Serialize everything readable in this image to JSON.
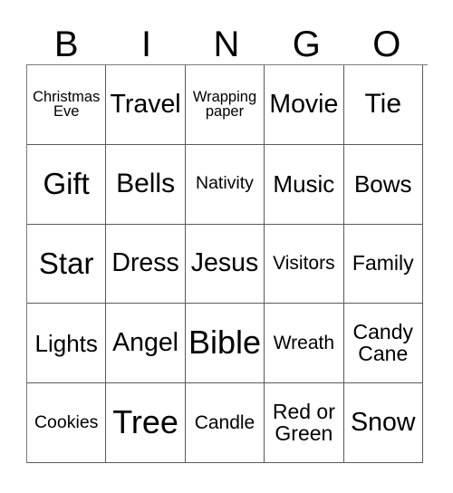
{
  "card": {
    "headers": [
      "B",
      "I",
      "N",
      "G",
      "O"
    ],
    "rows": [
      [
        {
          "text": "Christmas\nEve",
          "size": "fs-16"
        },
        {
          "text": "Travel",
          "size": "fs-28"
        },
        {
          "text": "Wrapping\npaper",
          "size": "fs-16"
        },
        {
          "text": "Movie",
          "size": "fs-28"
        },
        {
          "text": "Tie",
          "size": "fs-30"
        }
      ],
      [
        {
          "text": "Gift",
          "size": "fs-33"
        },
        {
          "text": "Bells",
          "size": "fs-30"
        },
        {
          "text": "Nativity",
          "size": "fs-19"
        },
        {
          "text": "Music",
          "size": "fs-26"
        },
        {
          "text": "Bows",
          "size": "fs-26"
        }
      ],
      [
        {
          "text": "Star",
          "size": "fs-33"
        },
        {
          "text": "Dress",
          "size": "fs-28"
        },
        {
          "text": "Jesus",
          "size": "fs-28"
        },
        {
          "text": "Visitors",
          "size": "fs-21"
        },
        {
          "text": "Family",
          "size": "fs-23"
        }
      ],
      [
        {
          "text": "Lights",
          "size": "fs-26"
        },
        {
          "text": "Angel",
          "size": "fs-28"
        },
        {
          "text": "Bible",
          "size": "fs-36"
        },
        {
          "text": "Wreath",
          "size": "fs-21"
        },
        {
          "text": "Candy\nCane",
          "size": "fs-23"
        }
      ],
      [
        {
          "text": "Cookies",
          "size": "fs-19"
        },
        {
          "text": "Tree",
          "size": "fs-36"
        },
        {
          "text": "Candle",
          "size": "fs-21"
        },
        {
          "text": "Red or\nGreen",
          "size": "fs-23"
        },
        {
          "text": "Snow",
          "size": "fs-28"
        }
      ]
    ]
  },
  "colors": {
    "text": "#000000",
    "border": "#5a5a5a",
    "background": "#ffffff"
  }
}
